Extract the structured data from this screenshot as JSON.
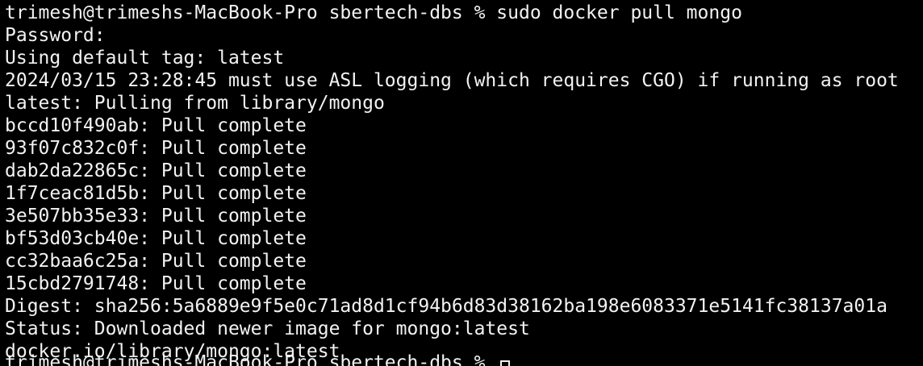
{
  "terminal": {
    "lines": [
      "trimesh@trimeshs-MacBook-Pro sbertech-dbs % sudo docker pull mongo",
      "Password:",
      "Using default tag: latest",
      "2024/03/15 23:28:45 must use ASL logging (which requires CGO) if running as root",
      "latest: Pulling from library/mongo",
      "bccd10f490ab: Pull complete",
      "93f07c832c0f: Pull complete",
      "dab2da22865c: Pull complete",
      "1f7ceac81d5b: Pull complete",
      "3e507bb35e33: Pull complete",
      "bf53d03cb40e: Pull complete",
      "cc32baa6c25a: Pull complete",
      "15cbd2791748: Pull complete",
      "Digest: sha256:5a6889e9f5e0c71ad8d1cf94b6d83d38162ba198e6083371e5141fc38137a01a",
      "Status: Downloaded newer image for mongo:latest",
      "docker.io/library/mongo:latest"
    ],
    "next_prompt": "trimesh@trimeshs-MacBook-Pro sbertech-dbs % "
  },
  "colors": {
    "background": "#000000",
    "foreground": "#f2f2f2"
  }
}
